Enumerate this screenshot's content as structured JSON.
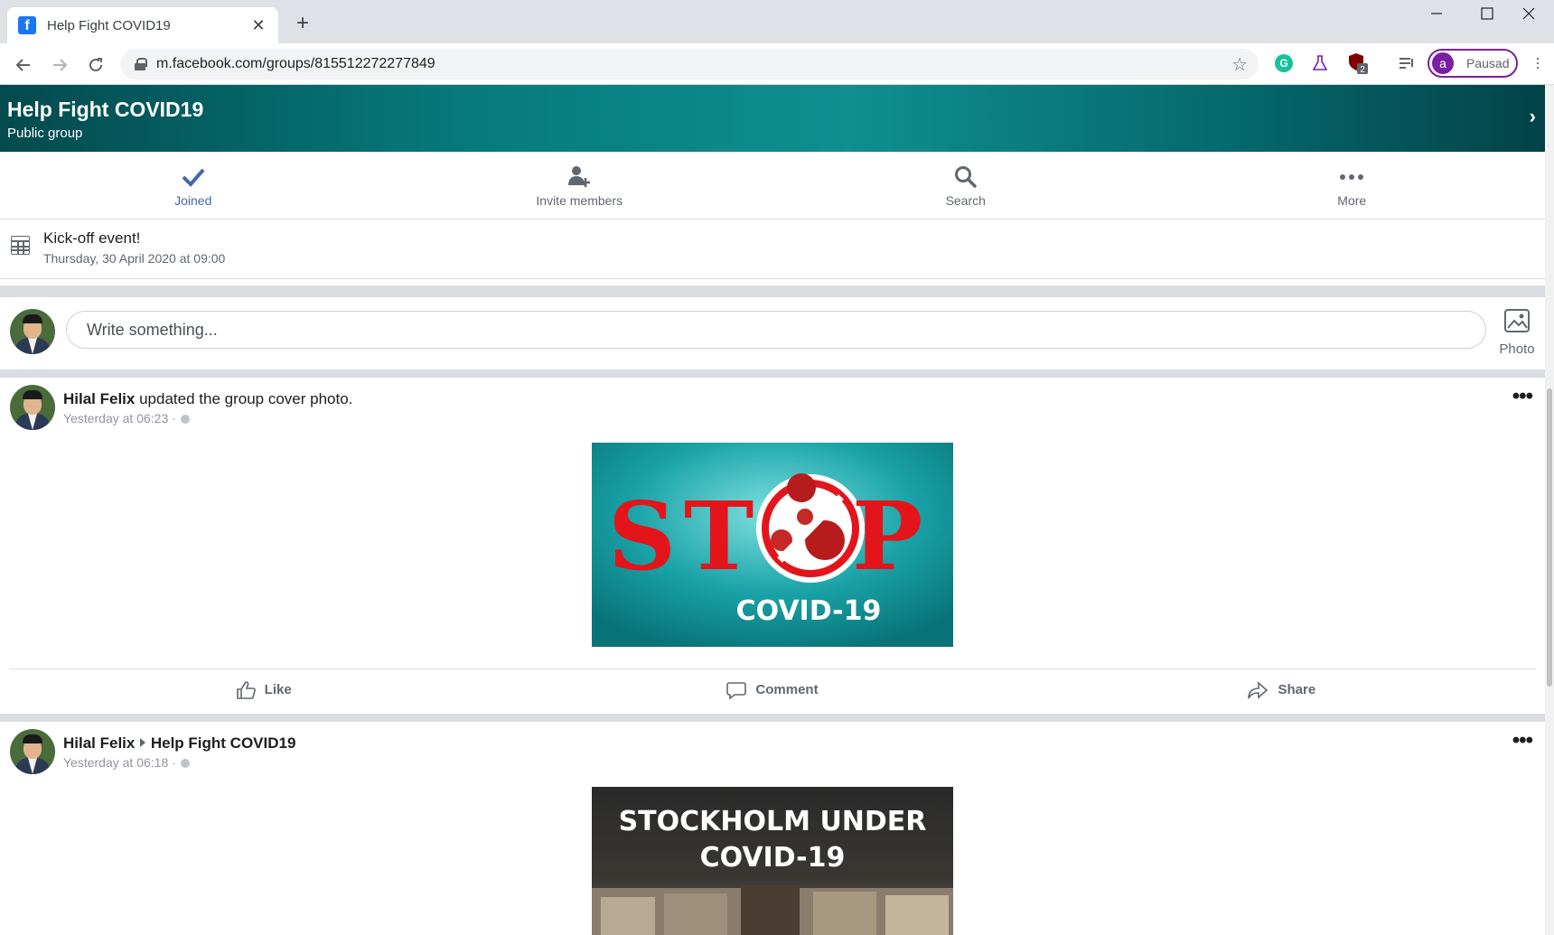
{
  "browser": {
    "tab_title": "Help Fight COVID19",
    "tab_close": "✕",
    "new_tab": "+",
    "url": "m.facebook.com/groups/815512272277849",
    "profile_initial": "a",
    "profile_name": "Pausad",
    "ext_badge": "2"
  },
  "group": {
    "name": "Help Fight COVID19",
    "type": "Public group"
  },
  "actions": [
    {
      "label": "Joined"
    },
    {
      "label": "Invite members"
    },
    {
      "label": "Search"
    },
    {
      "label": "More"
    }
  ],
  "event": {
    "title": "Kick-off event!",
    "date": "Thursday, 30 April 2020 at 09:00"
  },
  "composer": {
    "placeholder": "Write something...",
    "photo_label": "Photo"
  },
  "posts": [
    {
      "author": "Hilal Felix",
      "action": " updated the group cover photo.",
      "time": "Yesterday at 06:23 ·",
      "image_text": [
        "STOP",
        "COVID-19"
      ]
    },
    {
      "author": "Hilal Felix",
      "target": "Help Fight COVID19",
      "time": "Yesterday at 06:18 ·",
      "image_text": [
        "STOCKHOLM UNDER",
        "COVID-19"
      ]
    }
  ],
  "reactions": {
    "like": "Like",
    "comment": "Comment",
    "share": "Share"
  },
  "colors": {
    "accent": "#4267b2",
    "cover_start": "#044a4e",
    "cover_mid": "#0f8f8f",
    "stop_red": "#e3151a",
    "stop_bg": "#1aa3a8"
  }
}
